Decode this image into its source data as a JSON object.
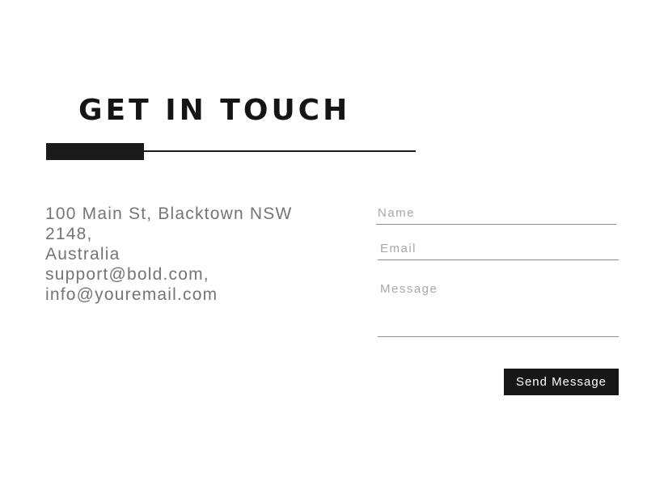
{
  "heading": {
    "title": "GET IN TOUCH"
  },
  "contact_info": {
    "lines": [
      "100 Main St, Blacktown NSW",
      "2148,",
      "Australia",
      "support@bold.com,",
      "info@youremail.com"
    ]
  },
  "form": {
    "name_placeholder": "Name",
    "name_value": "",
    "email_placeholder": "Email",
    "email_value": "",
    "message_placeholder": "Message",
    "message_value": "",
    "submit_label": "Send Message"
  },
  "colors": {
    "background": "#ffffff",
    "accent": "#171717",
    "text_muted": "#757575",
    "placeholder": "#a8a8a8",
    "underline": "#8c8c8c"
  }
}
